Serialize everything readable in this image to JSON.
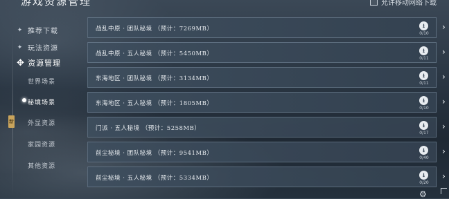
{
  "header": {
    "title": "游戏资源管理",
    "allow_mobile_label": "允许移动网络下载"
  },
  "sidebar": {
    "items": [
      {
        "label": "推荐下载",
        "icon": "sparkle-icon"
      },
      {
        "label": "玩法资源",
        "icon": "sparkle-icon"
      },
      {
        "label": "资源管理",
        "icon": "compass-icon"
      }
    ],
    "sub_items": [
      {
        "label": "世界场景"
      },
      {
        "label": "秘境场景"
      },
      {
        "label": "外显资源"
      },
      {
        "label": "家园资源"
      },
      {
        "label": "其他资源"
      }
    ],
    "tag": "新"
  },
  "list": {
    "rows": [
      {
        "label": "战乱中原 · 团队秘境 （预计：7269MB）",
        "count": "0/10"
      },
      {
        "label": "战乱中原 · 五人秘境 （预计：5450MB）",
        "count": "0/11"
      },
      {
        "label": "东海地区 · 团队秘境 （预计：3134MB）",
        "count": "0/11"
      },
      {
        "label": "东海地区 · 五人秘境 （预计：1805MB）",
        "count": "0/10"
      },
      {
        "label": "门派 · 五人秘境 （预计：5258MB）",
        "count": "0/17"
      },
      {
        "label": "前尘秘境 · 团队秘境 （预计：9541MB）",
        "count": "0/40"
      },
      {
        "label": "前尘秘境 · 五人秘境 （预计：5334MB）",
        "count": "0/20"
      }
    ],
    "download_icon": "download-icon",
    "arrow_icon": "chevron-right-icon"
  }
}
